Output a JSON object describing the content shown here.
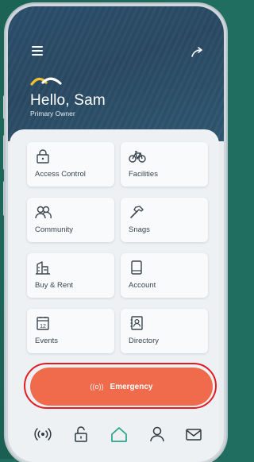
{
  "header": {
    "greeting": "Hello, Sam",
    "role": "Primary Owner"
  },
  "tiles": [
    {
      "label": "Access Control",
      "icon": "lock-icon"
    },
    {
      "label": "Facilities",
      "icon": "bicycle-icon"
    },
    {
      "label": "Community",
      "icon": "people-icon"
    },
    {
      "label": "Snags",
      "icon": "hammer-icon"
    },
    {
      "label": "Buy & Rent",
      "icon": "buildings-icon"
    },
    {
      "label": "Account",
      "icon": "tablet-icon"
    },
    {
      "label": "Events",
      "icon": "calendar-icon"
    },
    {
      "label": "Directory",
      "icon": "contacts-book-icon"
    }
  ],
  "calendar_day": "12",
  "emergency": {
    "label": "Emergency",
    "icon_text": "((o))"
  },
  "bottom_nav": [
    {
      "icon": "broadcast-icon"
    },
    {
      "icon": "unlock-icon"
    },
    {
      "icon": "home-icon",
      "active": true
    },
    {
      "icon": "person-icon"
    },
    {
      "icon": "mail-icon"
    }
  ],
  "colors": {
    "background": "#1f6e5f",
    "header": "#2c4f6e",
    "emergency": "#f06a4c",
    "annotation_ring": "#e31b23",
    "icon_dark": "#3a4650",
    "nav_active": "#2aa38d"
  }
}
